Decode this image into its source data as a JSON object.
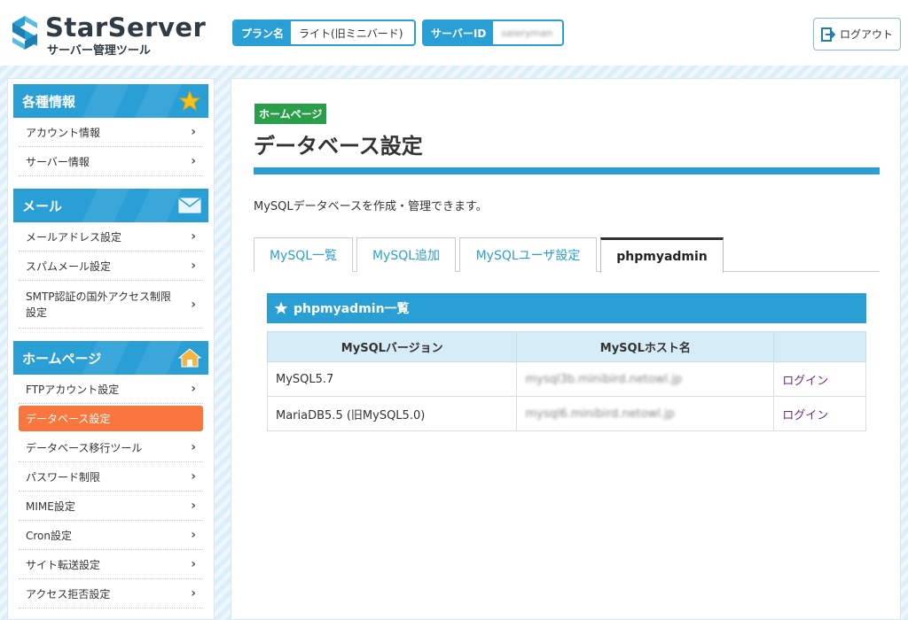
{
  "header": {
    "logo_title": "StarServer",
    "logo_sub": "サーバー管理ツール",
    "plan_label": "プラン名",
    "plan_value": "ライト(旧ミニバード)",
    "server_id_label": "サーバーID",
    "server_id_value": "saleryman",
    "logout_label": "ログアウト"
  },
  "sidebar": {
    "sections": [
      {
        "title": "各種情報",
        "icon": "star-icon",
        "items": [
          "アカウント情報",
          "サーバー情報"
        ]
      },
      {
        "title": "メール",
        "icon": "envelope-icon",
        "items": [
          "メールアドレス設定",
          "スパムメール設定",
          "SMTP認証の国外アクセス制限設定"
        ]
      },
      {
        "title": "ホームページ",
        "icon": "house-icon",
        "items": [
          "FTPアカウント設定",
          "データベース設定",
          "データベース移行ツール",
          "パスワード制限",
          "MIME設定",
          "Cron設定",
          "サイト転送設定",
          "アクセス拒否設定"
        ]
      }
    ],
    "active_item": "データベース設定"
  },
  "main": {
    "badge": "ホームページ",
    "title": "データベース設定",
    "description": "MySQLデータベースを作成・管理できます。",
    "tabs": [
      "MySQL一覧",
      "MySQL追加",
      "MySQLユーザ設定",
      "phpmyadmin"
    ],
    "active_tab": "phpmyadmin",
    "panel_title": "phpmyadmin一覧",
    "table": {
      "headers": [
        "MySQLバージョン",
        "MySQLホスト名",
        ""
      ],
      "rows": [
        {
          "version": "MySQL5.7",
          "host": "mysql3b.minibird.netowl.jp",
          "action": "ログイン"
        },
        {
          "version": "MariaDB5.5 (旧MySQL5.0)",
          "host": "mysql6.minibird.netowl.jp",
          "action": "ログイン"
        }
      ]
    }
  },
  "colors": {
    "primary": "#2a9fd6",
    "active_nav": "#f9763e",
    "badge": "#2a9f4a",
    "link": "#6b2a8a"
  }
}
